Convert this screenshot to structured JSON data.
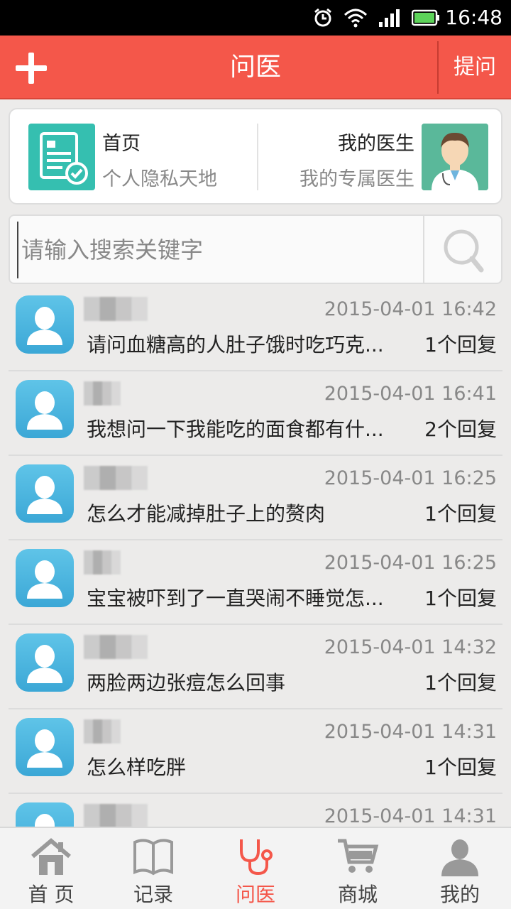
{
  "status_bar": {
    "time": "16:48"
  },
  "app_bar": {
    "title": "问医",
    "ask_label": "提问",
    "accent_color": "#f4574a"
  },
  "quick_card": {
    "left": {
      "title": "首页",
      "subtitle": "个人隐私天地"
    },
    "right": {
      "title": "我的医生",
      "subtitle": "我的专属医生"
    }
  },
  "search": {
    "placeholder": "请输入搜索关键字"
  },
  "questions": [
    {
      "time": "2015-04-01 16:42",
      "text": "请问血糖高的人肚子饿时吃巧克...",
      "replies": "1个回复"
    },
    {
      "time": "2015-04-01 16:41",
      "text": "我想问一下我能吃的面食都有什...",
      "replies": "2个回复"
    },
    {
      "time": "2015-04-01 16:25",
      "text": "怎么才能减掉肚子上的赘肉",
      "replies": "1个回复"
    },
    {
      "time": "2015-04-01 16:25",
      "text": "宝宝被吓到了一直哭闹不睡觉怎...",
      "replies": "1个回复"
    },
    {
      "time": "2015-04-01 14:32",
      "text": "两脸两边张痘怎么回事",
      "replies": "1个回复"
    },
    {
      "time": "2015-04-01 14:31",
      "text": "怎么样吃胖",
      "replies": "1个回复"
    },
    {
      "time": "2015-04-01 14:31",
      "text": "",
      "replies": ""
    }
  ],
  "bottom_nav": [
    {
      "label": "首 页",
      "icon": "home-icon"
    },
    {
      "label": "记录",
      "icon": "book-icon"
    },
    {
      "label": "问医",
      "icon": "stethoscope-icon",
      "active": true
    },
    {
      "label": "商城",
      "icon": "cart-icon"
    },
    {
      "label": "我的",
      "icon": "user-icon"
    }
  ]
}
